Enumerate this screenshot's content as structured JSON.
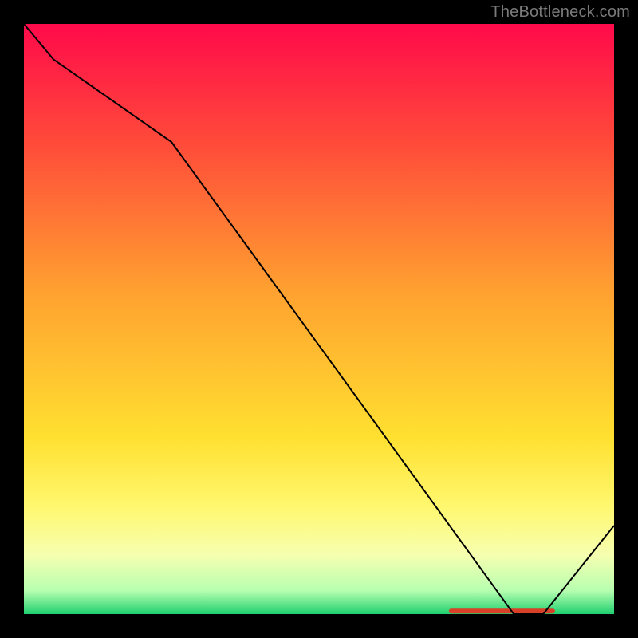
{
  "attribution": "TheBottleneck.com",
  "chart_data": {
    "type": "line",
    "title": "",
    "xlabel": "",
    "ylabel": "",
    "ylim": [
      0,
      1
    ],
    "x": [
      0.0,
      0.05,
      0.25,
      0.83,
      0.88,
      1.0
    ],
    "values": [
      1.0,
      0.94,
      0.8,
      0.0,
      0.0,
      0.15
    ],
    "line_color": "#000000",
    "line_width": 2,
    "background_gradient": {
      "stops": [
        {
          "offset": 0.0,
          "color": "#ff0a4a"
        },
        {
          "offset": 0.2,
          "color": "#ff4a3a"
        },
        {
          "offset": 0.45,
          "color": "#ffa030"
        },
        {
          "offset": 0.7,
          "color": "#ffe030"
        },
        {
          "offset": 0.82,
          "color": "#fff870"
        },
        {
          "offset": 0.9,
          "color": "#f6ffb0"
        },
        {
          "offset": 0.96,
          "color": "#b8ffb0"
        },
        {
          "offset": 1.0,
          "color": "#20d070"
        }
      ]
    },
    "marker_band": {
      "x_start": 0.72,
      "x_end": 0.9,
      "y": 0.005,
      "color": "#d84028"
    }
  }
}
